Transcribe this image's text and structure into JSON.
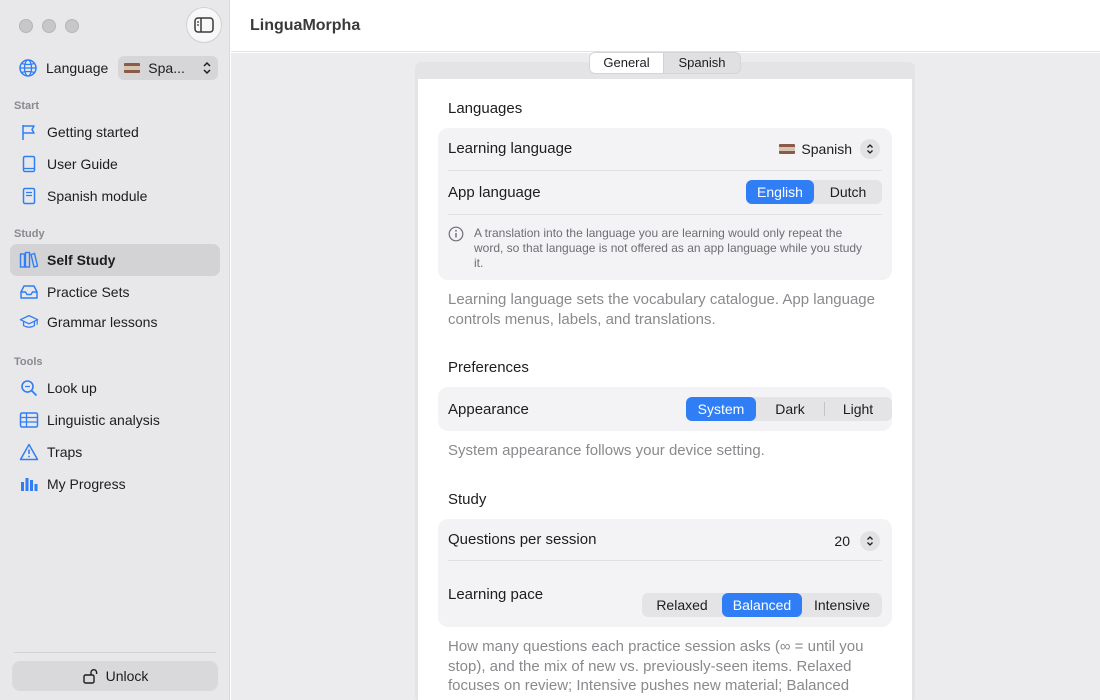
{
  "app": {
    "title": "LinguaMorpha"
  },
  "sidebar": {
    "language_label": "Language",
    "language_value": "Spa...",
    "sections": {
      "start": "Start",
      "study": "Study",
      "tools": "Tools"
    },
    "items": [
      {
        "label": "Getting started",
        "icon": "flag-icon"
      },
      {
        "label": "User Guide",
        "icon": "book-icon"
      },
      {
        "label": "Spanish module",
        "icon": "document-icon"
      },
      {
        "label": "Self Study",
        "icon": "books-icon",
        "active": true
      },
      {
        "label": "Practice Sets",
        "icon": "tray-icon"
      },
      {
        "label": "Grammar lessons",
        "icon": "graduation-cap-icon"
      },
      {
        "label": "Look up",
        "icon": "magnifier-icon"
      },
      {
        "label": "Linguistic analysis",
        "icon": "table-icon"
      },
      {
        "label": "Traps",
        "icon": "warning-icon"
      },
      {
        "label": "My Progress",
        "icon": "bar-chart-icon"
      }
    ],
    "unlock_label": "Unlock"
  },
  "tabs": [
    {
      "label": "General",
      "selected": true
    },
    {
      "label": "Spanish",
      "selected": false
    }
  ],
  "languages": {
    "heading": "Languages",
    "learning_label": "Learning language",
    "learning_value": "Spanish",
    "app_label": "App language",
    "app_options": [
      "English",
      "Dutch"
    ],
    "app_selected": "English",
    "note": "A translation into the language you are learning would only repeat the word, so that language is not offered as an app language while you study it.",
    "description": "Learning language sets the vocabulary catalogue. App language controls menus, labels, and translations."
  },
  "preferences": {
    "heading": "Preferences",
    "appearance_label": "Appearance",
    "appearance_options": [
      "System",
      "Dark",
      "Light"
    ],
    "appearance_selected": "System",
    "description": "System appearance follows your device setting."
  },
  "study": {
    "heading": "Study",
    "questions_label": "Questions per session",
    "questions_value": "20",
    "pace_label": "Learning pace",
    "pace_options": [
      "Relaxed",
      "Balanced",
      "Intensive"
    ],
    "pace_selected": "Balanced",
    "description": "How many questions each practice session asks (∞ = until you stop), and the mix of new vs. previously-seen items. Relaxed focuses on review; Intensive pushes new material; Balanced"
  },
  "colors": {
    "accent": "#2f7ef6",
    "sidebar_bg": "#e8e8ea"
  }
}
